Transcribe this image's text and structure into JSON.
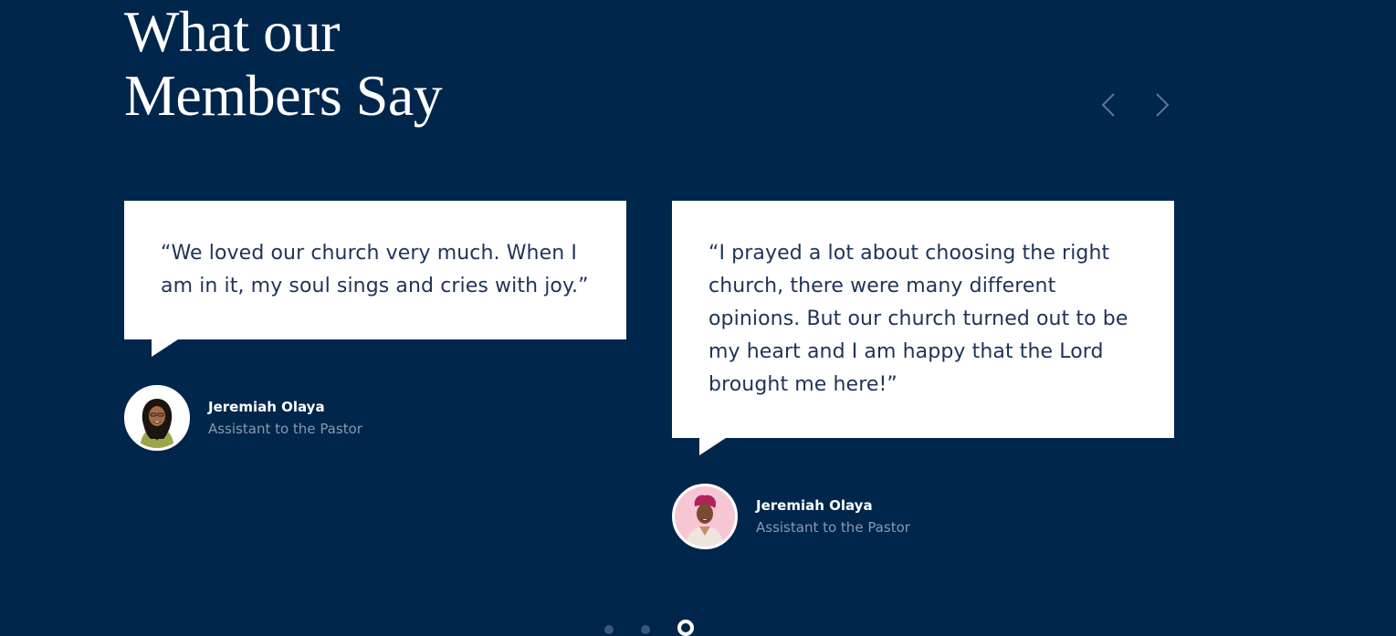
{
  "section": {
    "heading_line1": "What our",
    "heading_line2": "Members Say"
  },
  "carousel": {
    "prev_icon": "chevron-left-icon",
    "next_icon": "chevron-right-icon",
    "dots_count": 3,
    "active_dot": 3
  },
  "testimonials": [
    {
      "quote": "“We loved our church very much. When I am in it, my soul sings and cries with joy.”",
      "name": "Jeremiah Olaya",
      "role": "Assistant to the Pastor"
    },
    {
      "quote": "“I prayed a lot about choosing the right church, there were many different opinions. But our church turned out to be my heart and I am happy that the Lord brought me here!”",
      "name": "Jeremiah Olaya",
      "role": "Assistant to the Pastor"
    }
  ],
  "colors": {
    "background": "#00264c",
    "card": "#ffffff",
    "quote_text": "#1f3356",
    "muted_text": "#8a98ad",
    "arrow": "#5f7694"
  }
}
